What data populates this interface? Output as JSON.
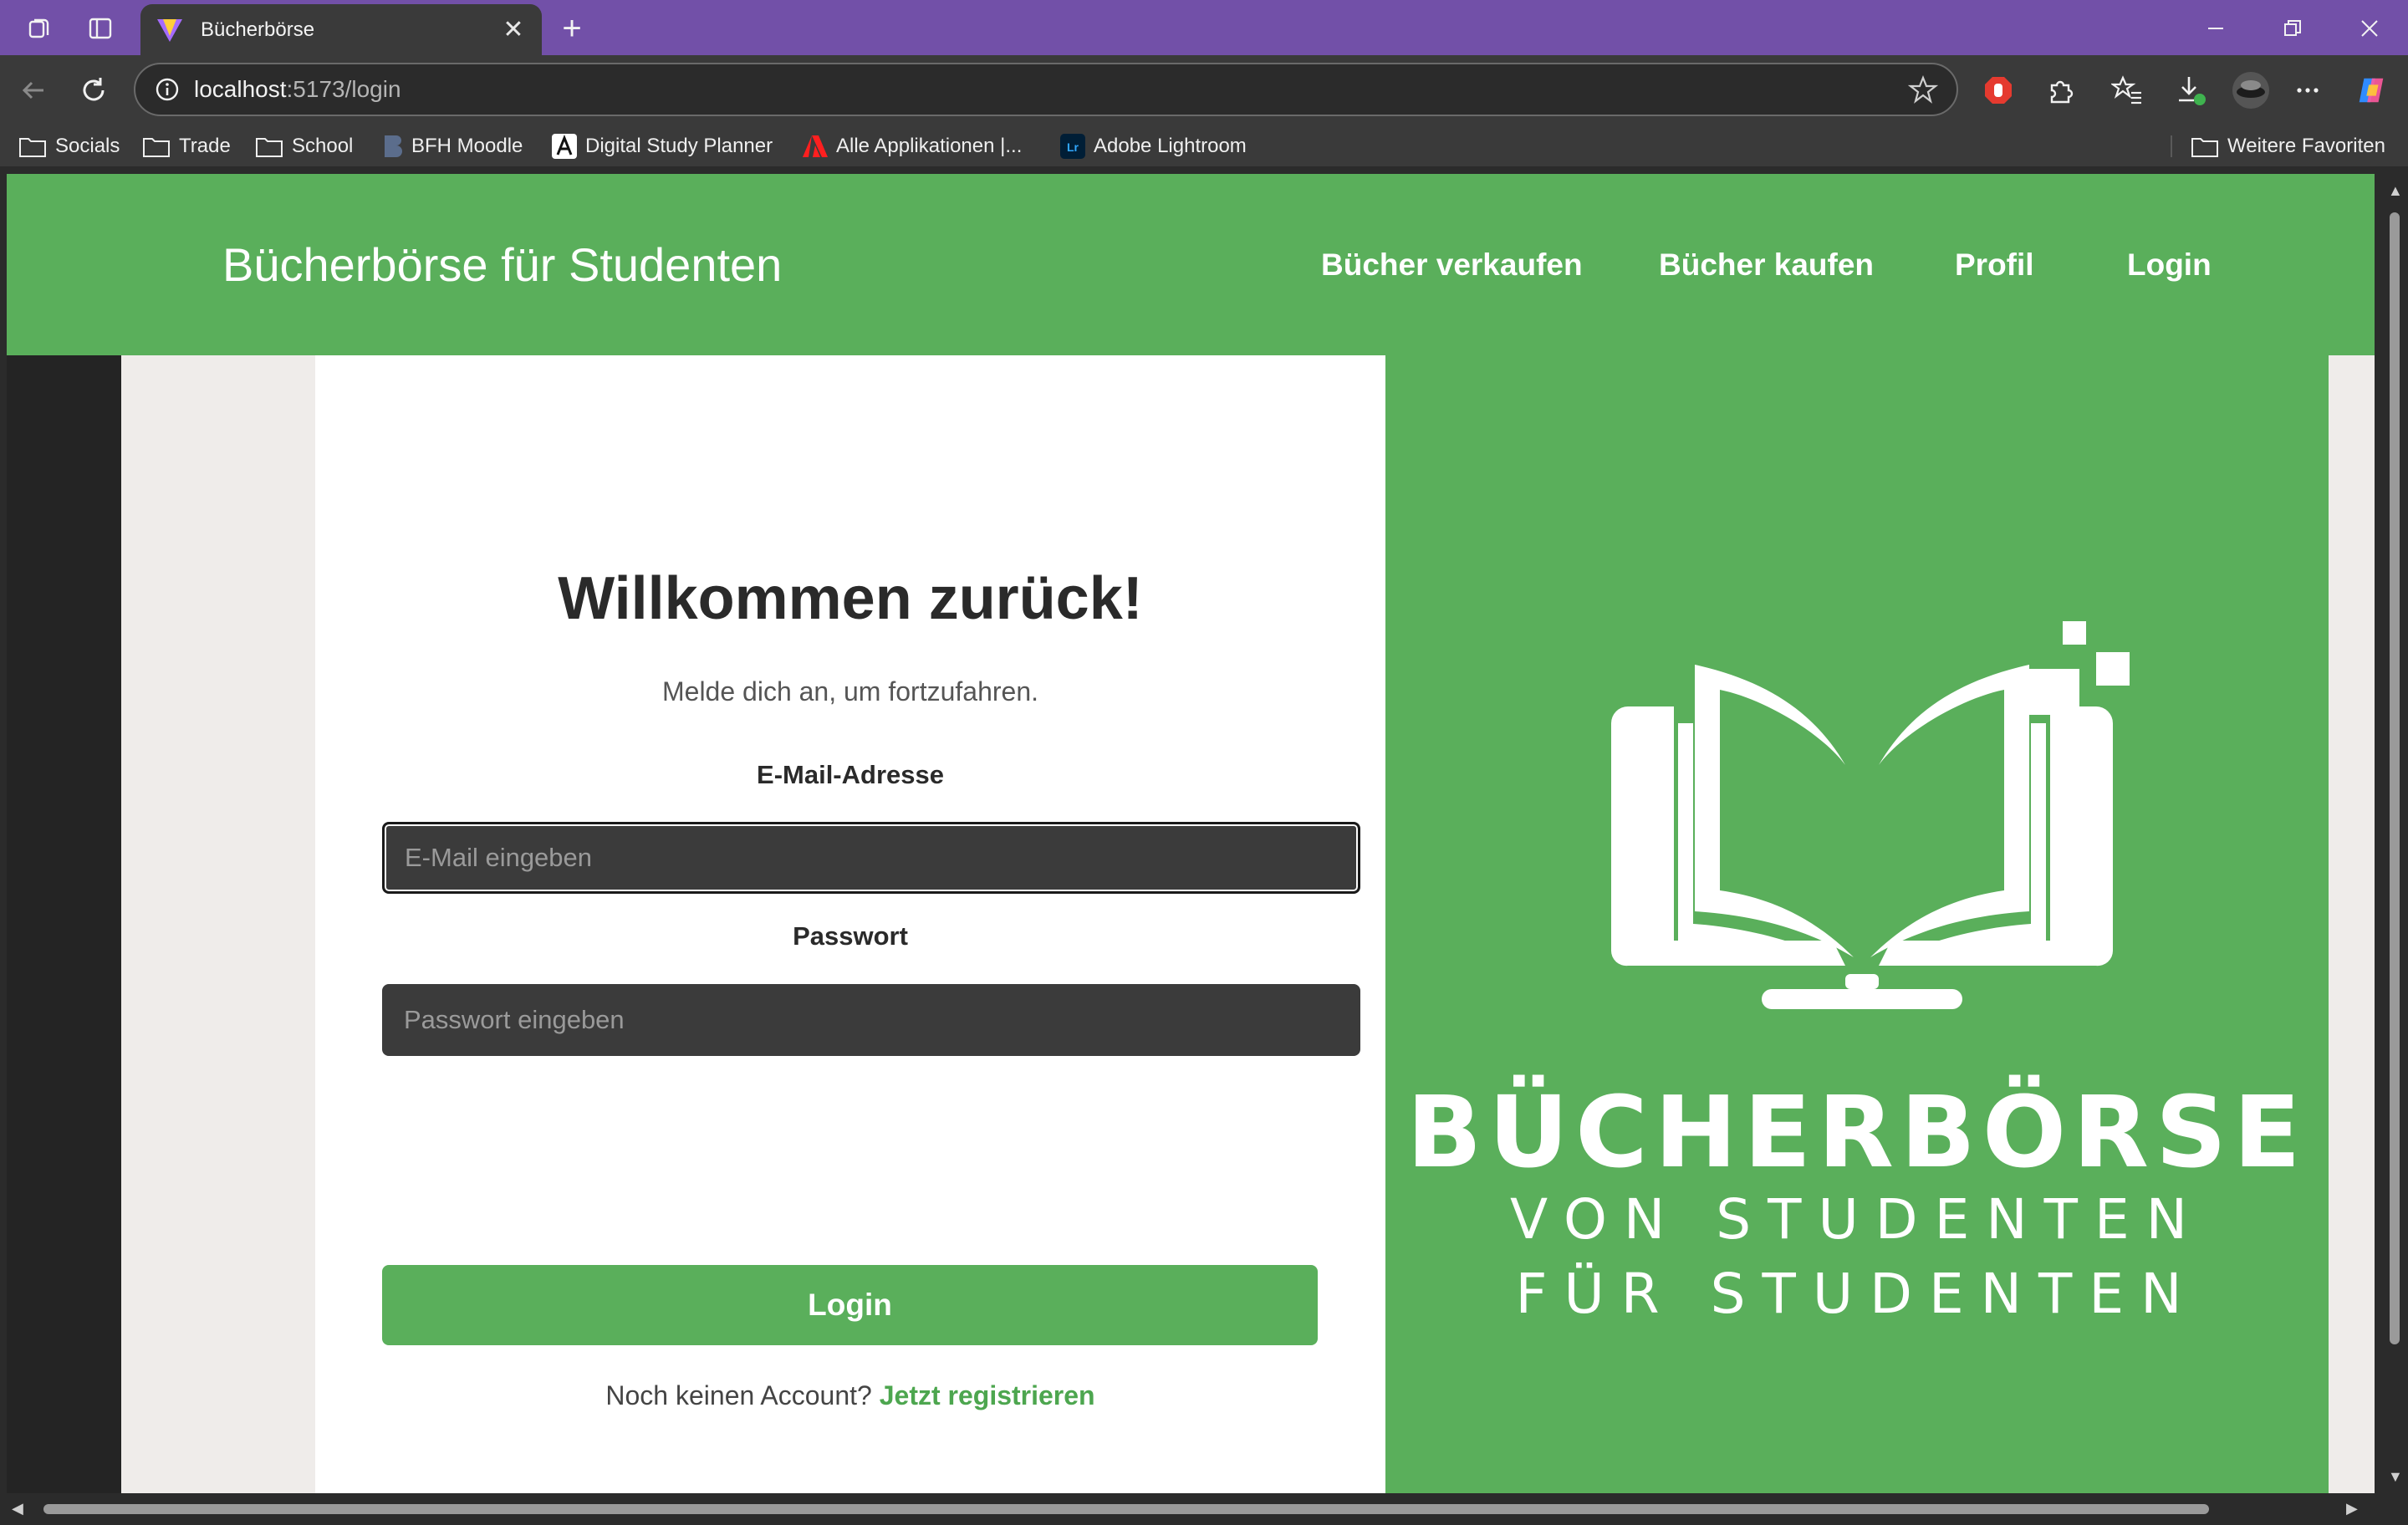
{
  "browser": {
    "tab_title": "Bücherbörse",
    "url_host": "localhost",
    "url_path": ":5173/login",
    "accent_color": "#7250a8"
  },
  "bookmarks": [
    {
      "label": "Socials",
      "icon": "folder-icon"
    },
    {
      "label": "Trade",
      "icon": "folder-icon"
    },
    {
      "label": "School",
      "icon": "folder-icon"
    },
    {
      "label": "BFH Moodle",
      "icon": "moodle-icon"
    },
    {
      "label": "Digital Study Planner",
      "icon": "planner-icon"
    },
    {
      "label": "Alle Applikationen |...",
      "icon": "adobe-icon"
    },
    {
      "label": "Adobe Lightroom",
      "icon": "lightroom-icon"
    }
  ],
  "bookmarks_other": "Weitere Favoriten",
  "nav": {
    "brand": "Bücherbörse für Studenten",
    "links": [
      "Bücher verkaufen",
      "Bücher kaufen",
      "Profil",
      "Login"
    ],
    "color": "#5aaf5b"
  },
  "form": {
    "title": "Willkommen zurück!",
    "subtitle": "Melde dich an, um fortzufahren.",
    "email_label": "E-Mail-Adresse",
    "email_placeholder": "E-Mail eingeben",
    "password_label": "Passwort",
    "password_placeholder": "Passwort eingeben",
    "submit_label": "Login",
    "register_text": "Noch keinen Account?",
    "register_link": "Jetzt registrieren"
  },
  "logo": {
    "title": "BÜCHERBÖRSE",
    "line1": "VON STUDENTEN",
    "line2": "FÜR STUDENTEN"
  }
}
